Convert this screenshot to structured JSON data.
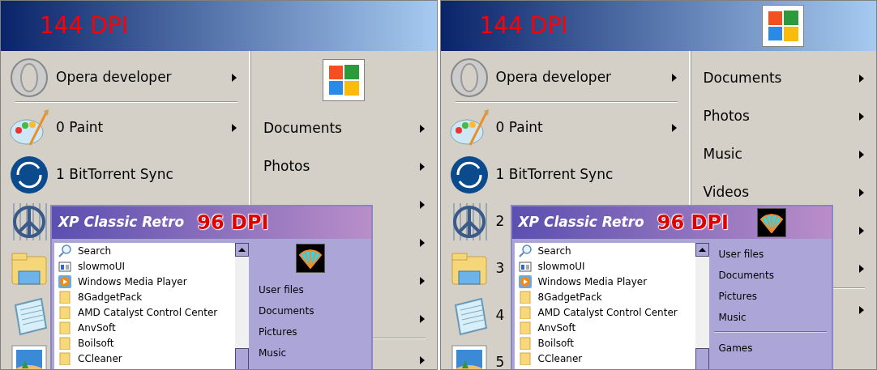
{
  "panels": [
    {
      "big_menu": {
        "annotation": "144 DPI",
        "logo_in_header": false,
        "programs": [
          {
            "kind": "entry",
            "label": "Opera developer",
            "submenu": true
          },
          {
            "kind": "separator"
          },
          {
            "kind": "entry",
            "label": "0 Paint",
            "submenu": true
          },
          {
            "kind": "entry",
            "label": "1 BitTorrent Sync",
            "submenu": false
          },
          {
            "kind": "covered"
          },
          {
            "kind": "covered"
          },
          {
            "kind": "covered"
          },
          {
            "kind": "covered"
          }
        ],
        "places": [
          {
            "kind": "entry",
            "label": "Documents",
            "submenu": true
          },
          {
            "kind": "entry",
            "label": "Photos",
            "submenu": true
          },
          {
            "kind": "covered",
            "submenu": true
          },
          {
            "kind": "covered",
            "submenu": true
          },
          {
            "kind": "covered",
            "submenu": true
          },
          {
            "kind": "covered",
            "submenu": true
          },
          {
            "kind": "separator"
          },
          {
            "kind": "covered",
            "submenu": true
          }
        ]
      },
      "small_menu": {
        "title": "XP Classic Retro",
        "annotation": "96 DPI",
        "logo_in_header": false,
        "programs": [
          "Search",
          "slowmoUI",
          "Windows Media Player",
          "8GadgetPack",
          "AMD Catalyst Control Center",
          "AnvSoft",
          "Boilsoft",
          "CCleaner"
        ],
        "places": [
          {
            "kind": "entry",
            "label": "User files"
          },
          {
            "kind": "entry",
            "label": "Documents"
          },
          {
            "kind": "entry",
            "label": "Pictures"
          },
          {
            "kind": "entry",
            "label": "Music"
          }
        ]
      }
    },
    {
      "big_menu": {
        "annotation": "144 DPI",
        "logo_in_header": true,
        "programs": [
          {
            "kind": "entry",
            "label": "Opera developer",
            "submenu": true
          },
          {
            "kind": "separator"
          },
          {
            "kind": "entry",
            "label": "0 Paint",
            "submenu": true
          },
          {
            "kind": "entry",
            "label": "1 BitTorrent Sync",
            "submenu": false
          },
          {
            "kind": "entry",
            "label": "2",
            "submenu": false
          },
          {
            "kind": "entry",
            "label": "3",
            "submenu": false
          },
          {
            "kind": "entry",
            "label": "4",
            "submenu": false
          },
          {
            "kind": "entry",
            "label": "5",
            "submenu": false
          }
        ],
        "places": [
          {
            "kind": "entry",
            "label": "Documents",
            "submenu": true
          },
          {
            "kind": "entry",
            "label": "Photos",
            "submenu": true
          },
          {
            "kind": "entry",
            "label": "Music",
            "submenu": true
          },
          {
            "kind": "entry",
            "label": "Videos",
            "submenu": true
          },
          {
            "kind": "covered",
            "submenu": true
          },
          {
            "kind": "covered",
            "submenu": true
          },
          {
            "kind": "separator"
          },
          {
            "kind": "covered",
            "submenu": true
          }
        ]
      },
      "small_menu": {
        "title": "XP Classic Retro",
        "annotation": "96 DPI",
        "logo_in_header": true,
        "programs": [
          "Search",
          "slowmoUI",
          "Windows Media Player",
          "8GadgetPack",
          "AMD Catalyst Control Center",
          "AnvSoft",
          "Boilsoft",
          "CCleaner"
        ],
        "places": [
          {
            "kind": "entry",
            "label": "User files"
          },
          {
            "kind": "entry",
            "label": "Documents"
          },
          {
            "kind": "entry",
            "label": "Pictures"
          },
          {
            "kind": "entry",
            "label": "Music"
          },
          {
            "kind": "separator"
          },
          {
            "kind": "entry",
            "label": "Games"
          }
        ]
      }
    }
  ]
}
